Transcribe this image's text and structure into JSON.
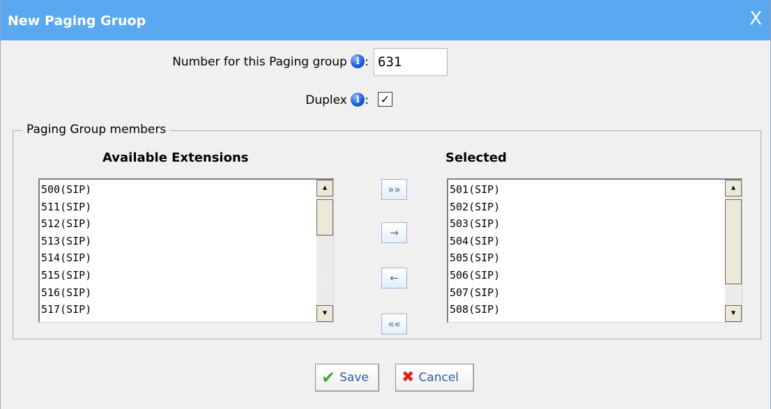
{
  "dialog": {
    "title": "New Paging Gruop",
    "close_glyph": "X"
  },
  "form": {
    "number_label": "Number for this Paging group",
    "number_value": "631",
    "duplex_label": "Duplex",
    "duplex_checked": true,
    "colon": ":"
  },
  "members": {
    "legend": "Paging Group members",
    "available_title": "Available Extensions",
    "selected_title": "Selected",
    "available": [
      "500(SIP)",
      "511(SIP)",
      "512(SIP)",
      "513(SIP)",
      "514(SIP)",
      "515(SIP)",
      "516(SIP)",
      "517(SIP)"
    ],
    "selected": [
      "501(SIP)",
      "502(SIP)",
      "503(SIP)",
      "504(SIP)",
      "505(SIP)",
      "506(SIP)",
      "507(SIP)",
      "508(SIP)"
    ]
  },
  "move_buttons": {
    "add_all": "»»",
    "add": "→",
    "remove": "←",
    "remove_all": "««"
  },
  "actions": {
    "save": "Save",
    "cancel": "Cancel"
  },
  "icons": {
    "info": "info-icon",
    "checkbox_mark": "☑",
    "save_icon": "check-icon",
    "cancel_icon": "x-icon",
    "scroll_up": "▲",
    "scroll_down": "▼"
  },
  "colors": {
    "titlebar": "#5aa8f0",
    "info_blue": "#1e5fd6",
    "button_text": "#2d5f9f"
  }
}
